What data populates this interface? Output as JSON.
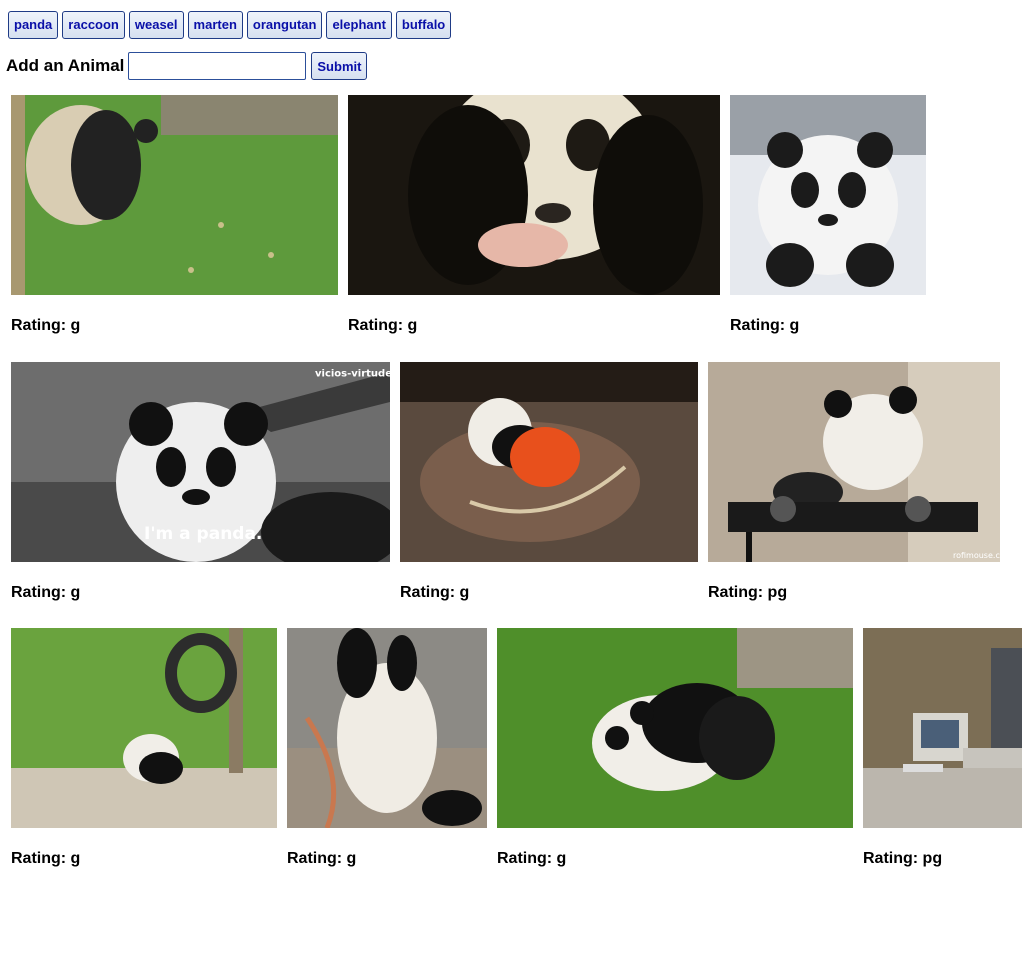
{
  "animals": [
    "panda",
    "raccoon",
    "weasel",
    "marten",
    "orangutan",
    "elephant",
    "buffalo"
  ],
  "form": {
    "label": "Add an Animal",
    "input_value": "",
    "input_placeholder": "",
    "submit_label": "Submit"
  },
  "gifs": [
    {
      "rating_label": "Rating: g",
      "scene": "panda-grass-sitting"
    },
    {
      "rating_label": "Rating: g",
      "scene": "panda-closeup-dark"
    },
    {
      "rating_label": "Rating: g",
      "scene": "panda-cub-snow"
    },
    {
      "rating_label": "Rating: g",
      "scene": "panda-bw-caption",
      "caption": "I'm a panda.",
      "watermark": "vicios-virtudes"
    },
    {
      "rating_label": "Rating: g",
      "scene": "panda-rocking-horse"
    },
    {
      "rating_label": "Rating: pg",
      "scene": "panda-dj-turntable",
      "watermark": "rofimouse.com"
    },
    {
      "rating_label": "Rating: g",
      "scene": "panda-tire-playground"
    },
    {
      "rating_label": "Rating: g",
      "scene": "panda-rocking-chair"
    },
    {
      "rating_label": "Rating: g",
      "scene": "panda-rolling-grass"
    },
    {
      "rating_label": "Rating: pg",
      "scene": "office-computer"
    }
  ]
}
